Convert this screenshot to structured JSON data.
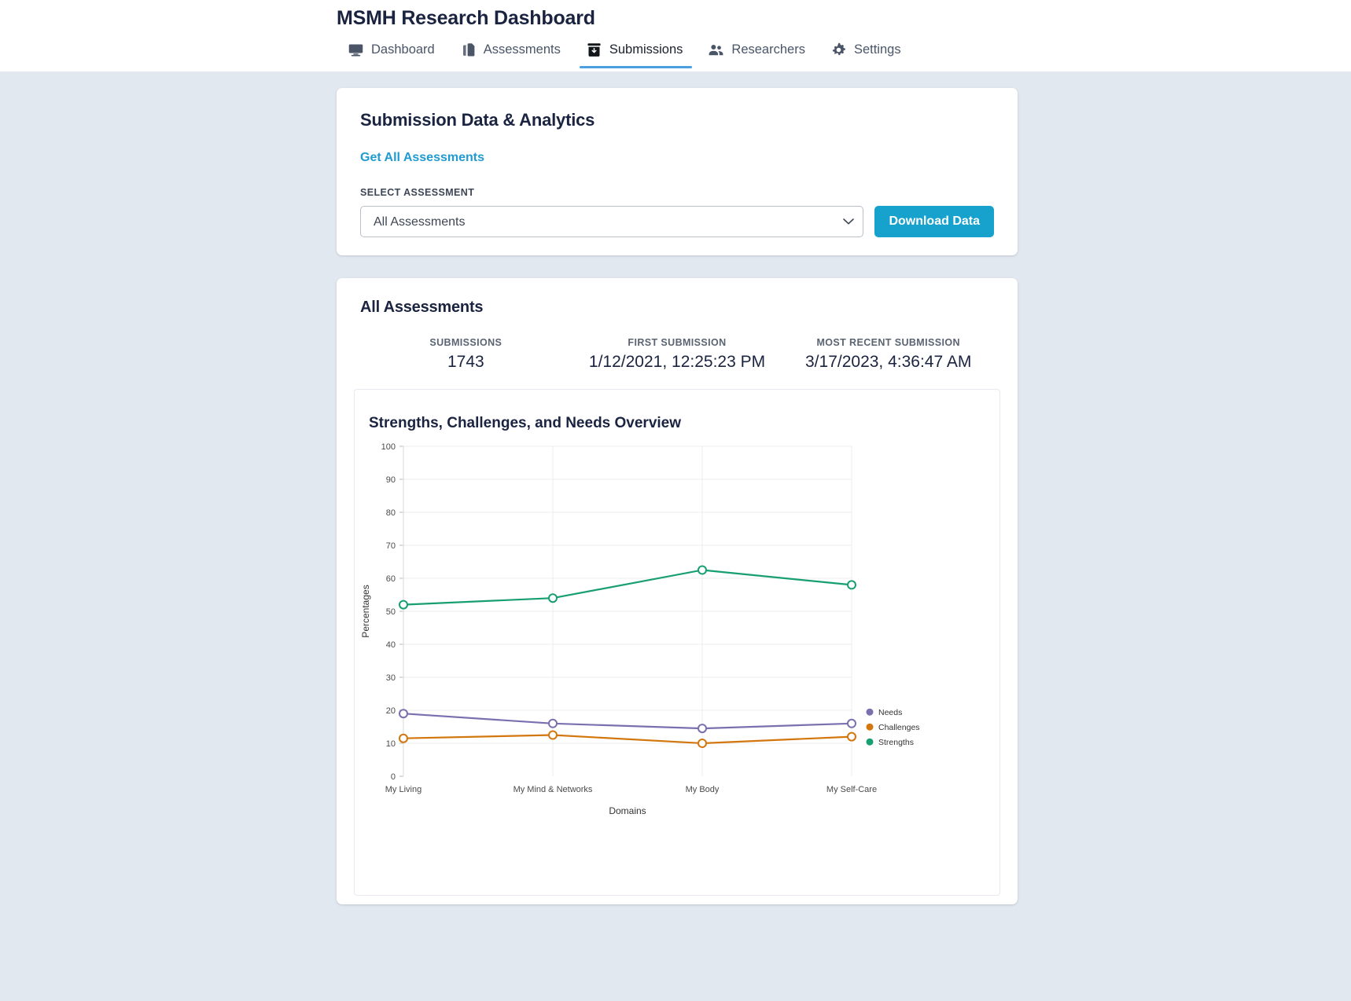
{
  "app": {
    "title": "MSMH Research Dashboard"
  },
  "nav": {
    "items": [
      {
        "label": "Dashboard",
        "icon": "monitor-icon",
        "active": false
      },
      {
        "label": "Assessments",
        "icon": "documents-icon",
        "active": false
      },
      {
        "label": "Submissions",
        "icon": "inbox-download-icon",
        "active": true
      },
      {
        "label": "Researchers",
        "icon": "people-icon",
        "active": false
      },
      {
        "label": "Settings",
        "icon": "gear-icon",
        "active": false
      }
    ]
  },
  "controls_card": {
    "title": "Submission Data & Analytics",
    "get_all_link": "Get All Assessments",
    "select_label": "SELECT ASSESSMENT",
    "select_value": "All Assessments",
    "select_options": [
      "All Assessments"
    ],
    "download_button": "Download Data"
  },
  "results_card": {
    "title": "All Assessments",
    "stats": [
      {
        "label": "SUBMISSIONS",
        "value": "1743"
      },
      {
        "label": "FIRST SUBMISSION",
        "value": "1/12/2021, 12:25:23 PM"
      },
      {
        "label": "MOST RECENT SUBMISSION",
        "value": "3/17/2023, 4:36:47 AM"
      }
    ]
  },
  "colors": {
    "accent_blue": "#17a2cd",
    "link_blue": "#1f9bd1",
    "tab_underline": "#4a9fe0",
    "needs": "#7b6fb0",
    "challenges": "#d2760d",
    "strengths": "#179e72",
    "page_bg": "#e2e8f0"
  },
  "chart_data": {
    "type": "line",
    "title": "Strengths, Challenges, and Needs Overview",
    "xlabel": "Domains",
    "ylabel": "Percentages",
    "categories": [
      "My Living",
      "My Mind & Networks",
      "My Body",
      "My Self-Care"
    ],
    "ylim": [
      0,
      100
    ],
    "yticks": [
      0,
      10,
      20,
      30,
      40,
      50,
      60,
      70,
      80,
      90,
      100
    ],
    "grid": true,
    "legend_position": "right",
    "series": [
      {
        "name": "Needs",
        "color": "#7b6fb0",
        "values": [
          19,
          16,
          14.5,
          16
        ]
      },
      {
        "name": "Challenges",
        "color": "#d2760d",
        "values": [
          11.5,
          12.5,
          10,
          12
        ]
      },
      {
        "name": "Strengths",
        "color": "#179e72",
        "values": [
          52,
          54,
          62.5,
          58
        ]
      }
    ]
  }
}
